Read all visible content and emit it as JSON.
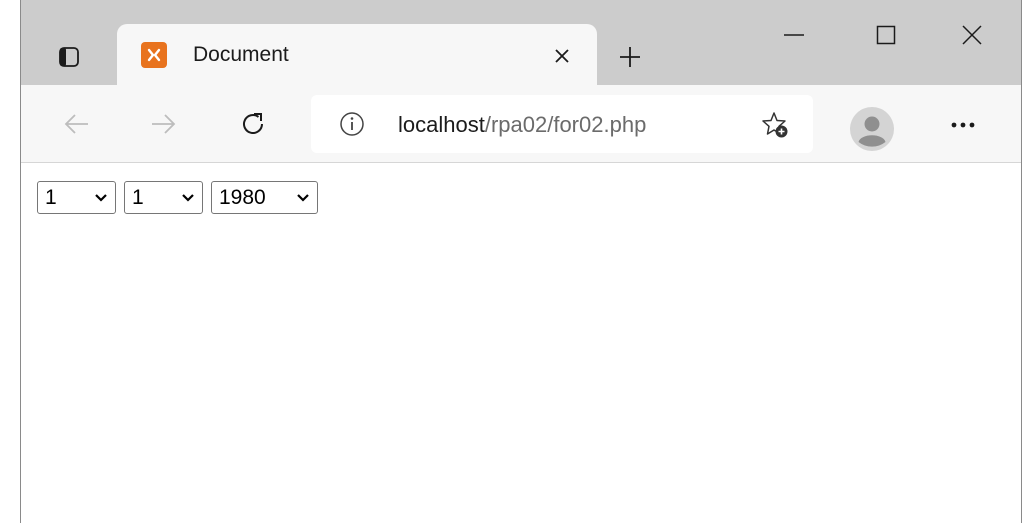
{
  "window": {
    "tab": {
      "title": "Document"
    },
    "controls": [
      "minimize",
      "maximize",
      "close"
    ]
  },
  "toolbar": {
    "url_host": "localhost",
    "url_path": "/rpa02/for02.php"
  },
  "form": {
    "day": {
      "selected": "1"
    },
    "month": {
      "selected": "1"
    },
    "year": {
      "selected": "1980"
    }
  },
  "colors": {
    "tab_strip": "#cccccc",
    "toolbar": "#f7f7f7",
    "favicon": "#e8731e"
  },
  "icons": [
    "tab-actions-icon",
    "xampp-favicon",
    "tab-close-icon",
    "new-tab-icon",
    "back-arrow-icon",
    "forward-arrow-icon",
    "reload-icon",
    "info-icon",
    "add-favorite-icon",
    "profile-avatar-icon",
    "more-options-icon",
    "chevron-down-icon"
  ]
}
